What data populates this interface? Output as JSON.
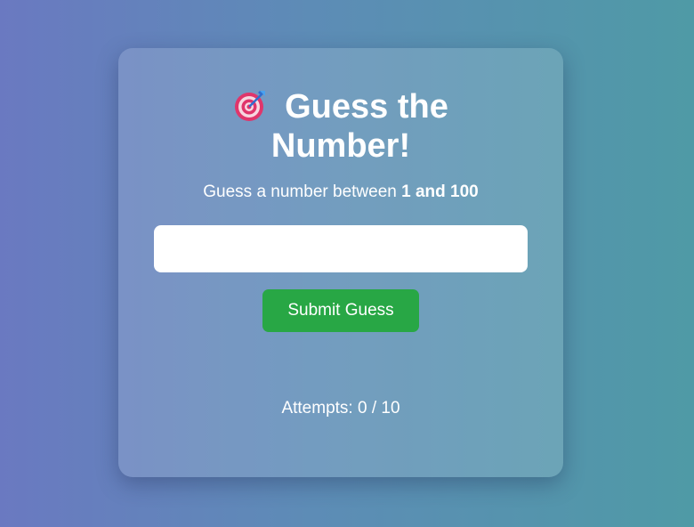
{
  "game": {
    "icon": "target-dart-icon",
    "title_line1": "Guess the",
    "title_line2": "Number!",
    "subtitle_prefix": "Guess a number between ",
    "subtitle_range": "1 and 100",
    "input_value": "",
    "input_placeholder": "",
    "submit_label": "Submit Guess",
    "attempts_text": "Attempts: 0 / 10"
  },
  "colors": {
    "background_start": "#6a79c1",
    "background_end": "#4f9aa6",
    "button": "#28a745",
    "text": "#ffffff"
  }
}
